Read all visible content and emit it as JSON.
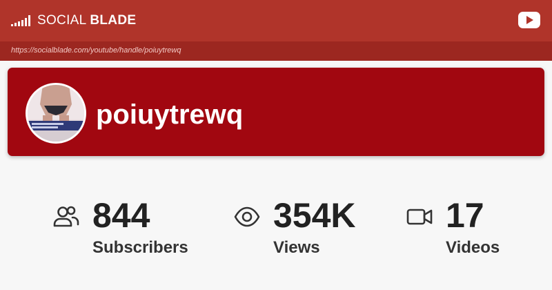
{
  "header": {
    "brand_light": "SOCIAL ",
    "brand_bold": "BLADE",
    "url": "https://socialblade.com/youtube/handle/poiuytrewq"
  },
  "channel": {
    "name": "poiuytrewq"
  },
  "stats": [
    {
      "value": "844",
      "label": "Subscribers",
      "icon": "users-icon"
    },
    {
      "value": "354K",
      "label": "Views",
      "icon": "eye-icon"
    },
    {
      "value": "17",
      "label": "Videos",
      "icon": "video-camera-icon"
    }
  ],
  "colors": {
    "topbar": "#b0342a",
    "urlbar": "#9c2720",
    "card": "#a10710",
    "background": "#f7f7f7"
  }
}
